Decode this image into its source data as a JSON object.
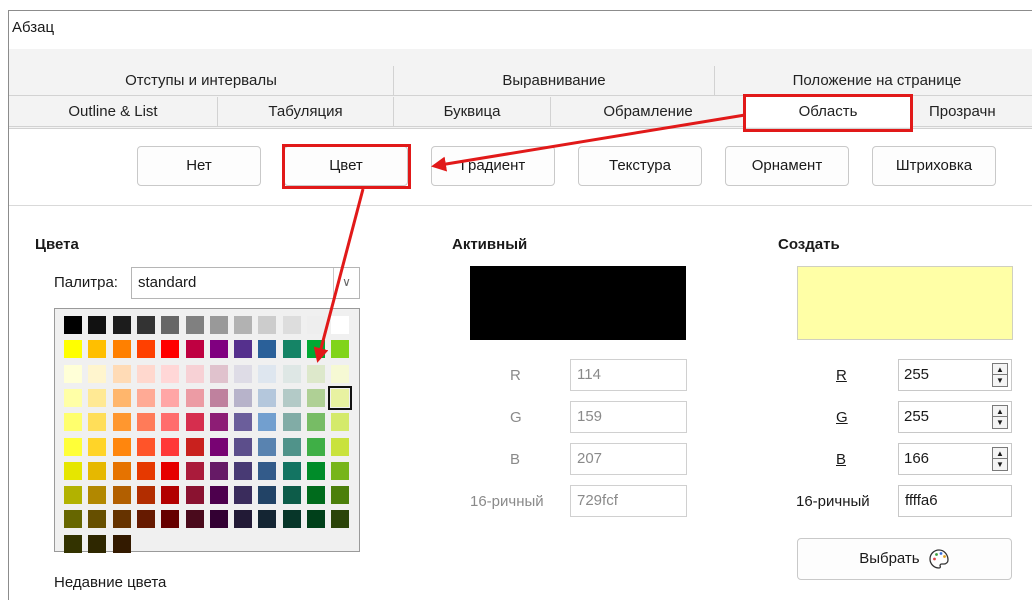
{
  "window": {
    "title": "Абзац"
  },
  "tabs_row1": [
    "Отступы и интервалы",
    "Выравнивание",
    "Положение на странице"
  ],
  "tabs_row2": [
    "Outline & List",
    "Табуляция",
    "Буквица",
    "Обрамление",
    "Область",
    "Прозрачн"
  ],
  "fill_buttons": {
    "none": "Нет",
    "color": "Цвет",
    "gradient": "Градиент",
    "texture": "Текстура",
    "pattern": "Орнамент",
    "hatching": "Штриховка"
  },
  "colors_section": {
    "heading": "Цвета",
    "palette_label": "Палитра:",
    "palette_value": "standard",
    "recent_label": "Недавние цвета"
  },
  "active_section": {
    "heading": "Активный",
    "color": "#000000",
    "r_label": "R",
    "r_value": "114",
    "g_label": "G",
    "g_value": "159",
    "b_label": "B",
    "b_value": "207",
    "hex_label": "16-ричный",
    "hex_value": "729fcf"
  },
  "new_section": {
    "heading": "Создать",
    "color": "#ffffa6",
    "r_label": "R",
    "r_value": "255",
    "g_label": "G",
    "g_value": "255",
    "b_label": "B",
    "b_value": "166",
    "hex_label": "16-ричный",
    "hex_value": "ffffa6",
    "pick_button": "Выбрать"
  },
  "palette_rows": [
    [
      "#000000",
      "#111111",
      "#1c1c1c",
      "#333333",
      "#666666",
      "#808080",
      "#999999",
      "#b2b2b2",
      "#cccccc",
      "#dddddd",
      "#eeeeee",
      "#ffffff"
    ],
    [
      "#ffff00",
      "#ffbf00",
      "#ff8000",
      "#ff4000",
      "#ff0000",
      "#bf0041",
      "#800080",
      "#55308d",
      "#2a6099",
      "#158466",
      "#00a933",
      "#81d41a"
    ],
    [
      "#ffffd7",
      "#fff5ce",
      "#ffdbb6",
      "#ffd8ce",
      "#ffd7d7",
      "#f7d1d5",
      "#e0c2cd",
      "#dedce6",
      "#dee6ef",
      "#dee7e5",
      "#dde8cb",
      "#f6f9d4"
    ],
    [
      "#ffffa6",
      "#ffe994",
      "#ffb66c",
      "#ffaa95",
      "#ffa6a6",
      "#ec9ba4",
      "#bf819e",
      "#b7b3ca",
      "#b4c7dc",
      "#b3cac7",
      "#afd095",
      "#e8f2a1"
    ],
    [
      "#ffff6d",
      "#ffde59",
      "#ff972f",
      "#ff7b59",
      "#ff6d6d",
      "#d62e4e",
      "#8d1d75",
      "#6b5e9b",
      "#729fcf",
      "#81aca6",
      "#77bc65",
      "#d4ea6b"
    ],
    [
      "#ffff38",
      "#ffd428",
      "#ff860d",
      "#ff5429",
      "#ff3838",
      "#c9211e",
      "#780373",
      "#5c4e8b",
      "#5983b0",
      "#50938a",
      "#3faf46",
      "#c9e23d"
    ],
    [
      "#e6e600",
      "#e6b800",
      "#e67300",
      "#e63900",
      "#e60000",
      "#aa1b3b",
      "#661a66",
      "#483a74",
      "#335b8a",
      "#137462",
      "#008c29",
      "#77b51a"
    ],
    [
      "#b2b200",
      "#b28800",
      "#b25f00",
      "#b22d00",
      "#b20000",
      "#8a1230",
      "#4d004d",
      "#3a2c5c",
      "#224366",
      "#0d5c49",
      "#006b1c",
      "#4b7f0b"
    ],
    [
      "#666600",
      "#664f00",
      "#663300",
      "#661a00",
      "#660000",
      "#4a0a1c",
      "#330033",
      "#221a36",
      "#142533",
      "#073629",
      "#00401a",
      "#2b4409"
    ],
    [
      "#333300",
      "#2e2700",
      "#331a00"
    ]
  ],
  "selected_swatch": "3-11"
}
